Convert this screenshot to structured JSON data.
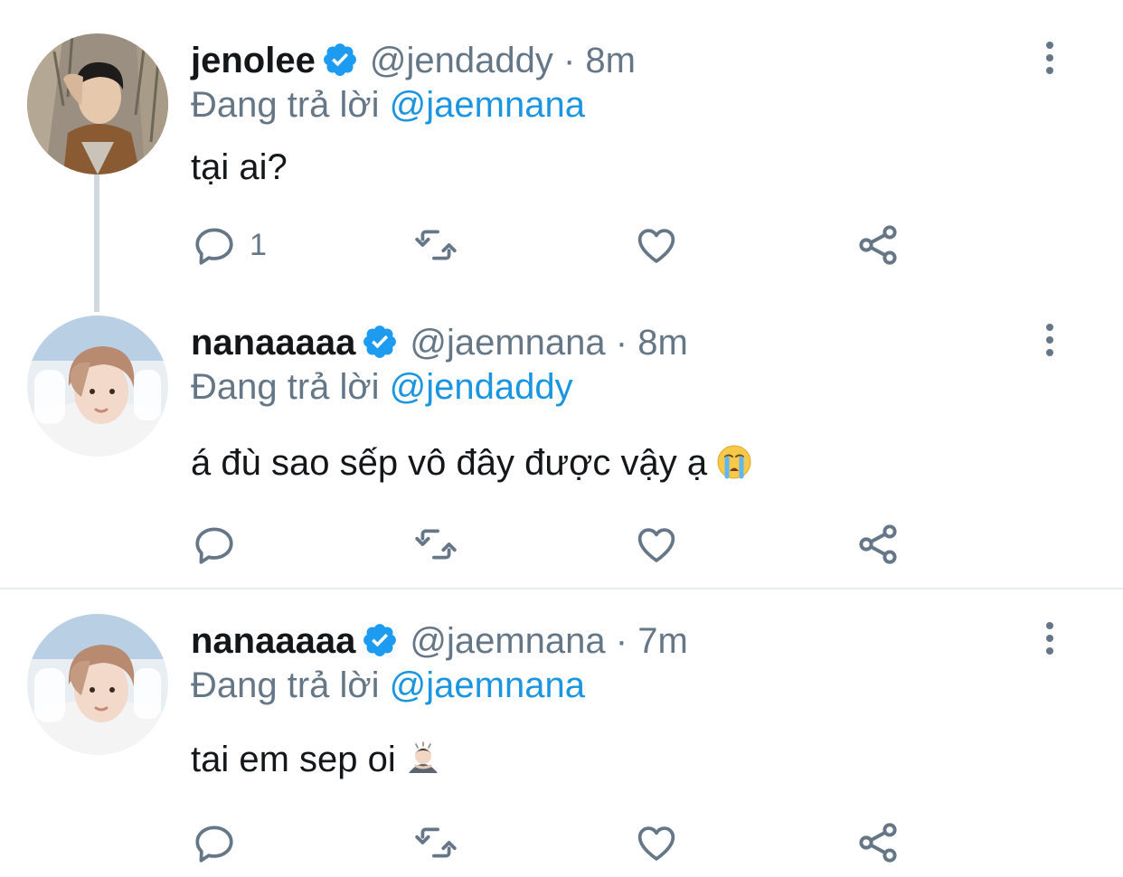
{
  "colors": {
    "accent": "#1b95e0",
    "text_primary": "#14171a",
    "text_secondary": "#657786",
    "icon": "#657786",
    "divider": "#e6ecf0",
    "thread_line": "#cfd9de"
  },
  "tweets": [
    {
      "display_name": "jenolee",
      "verified": true,
      "handle": "@jendaddy",
      "separator": "·",
      "time": "8m",
      "reply_prefix": "Đang trả lời",
      "reply_to": "@jaemnana",
      "text": "tại ai?",
      "emoji": "",
      "reply_count": "1",
      "icons": [
        "reply-icon",
        "retweet-icon",
        "like-icon",
        "share-icon",
        "more-icon",
        "verified-badge-icon"
      ]
    },
    {
      "display_name": "nanaaaaa",
      "verified": true,
      "handle": "@jaemnana",
      "separator": "·",
      "time": "8m",
      "reply_prefix": "Đang trả lời",
      "reply_to": "@jendaddy",
      "text": "á đù sao sếp vô đây được vậy ạ",
      "emoji": "loudly-crying-face-emoji",
      "reply_count": "",
      "icons": [
        "reply-icon",
        "retweet-icon",
        "like-icon",
        "share-icon",
        "more-icon",
        "verified-badge-icon"
      ]
    },
    {
      "display_name": "nanaaaaa",
      "verified": true,
      "handle": "@jaemnana",
      "separator": "·",
      "time": "7m",
      "reply_prefix": "Đang trả lời",
      "reply_to": "@jaemnana",
      "text": "tai em sep oi",
      "emoji": "person-bowing-emoji",
      "reply_count": "",
      "icons": [
        "reply-icon",
        "retweet-icon",
        "like-icon",
        "share-icon",
        "more-icon",
        "verified-badge-icon"
      ]
    }
  ]
}
